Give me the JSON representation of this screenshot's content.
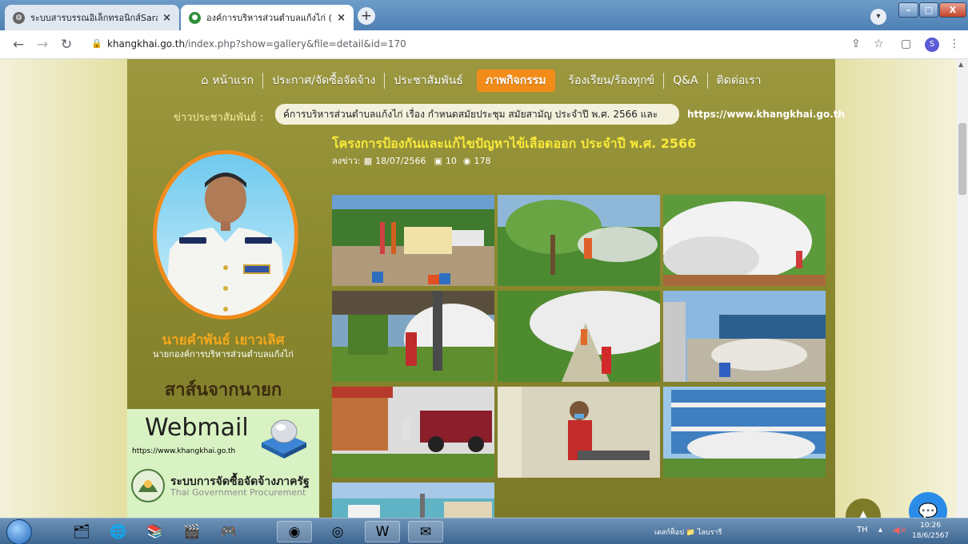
{
  "browser": {
    "tabs": [
      {
        "title": "ระบบสารบรรณอิเล็กทรอนิกส์Saraban",
        "active": false
      },
      {
        "title": "องค์การบริหารส่วนตำบลแก้งไก่ (อบต.แ",
        "active": true
      }
    ],
    "url_host": "khangkhai.go.th",
    "url_path": "/index.php?show=gallery&file=detail&id=170",
    "profile_initial": "S"
  },
  "site": {
    "menu": [
      {
        "label": "หน้าแรก",
        "icon": "home-icon"
      },
      {
        "label": "ประกาศ/จัดซื้อจัดจ้าง"
      },
      {
        "label": "ประชาสัมพันธ์"
      },
      {
        "label": "ภาพกิจกรรม",
        "active": true
      },
      {
        "label": "ร้องเรียน/ร้องทุกข์"
      },
      {
        "label": "Q&A"
      },
      {
        "label": "ติดต่อเรา"
      }
    ],
    "news_label": "ข่าวประชาสัมพันธ์ :",
    "news_ticker": "ค์การบริหารส่วนตำบลแก้งไก่ เรื่อง กำหนดสมัยประชุม สมัยสามัญ ประจำปี พ.ศ. 2566 และ",
    "news_url": "https://www.khangkhai.go.th",
    "mayor_name": "นายคำพันธ์ เยาวเลิศ",
    "mayor_title": "นายกองค์การบริหารส่วนตำบลแก้งไก่",
    "mayor_message": "สาส์นจากนายก",
    "webmail_title": "Webmail",
    "webmail_url": "https://www.khangkhai.go.th",
    "egp_title": "ระบบการจัดซื้อจัดจ้างภาครัฐ",
    "egp_subtitle": "Thai Government Procurement"
  },
  "article": {
    "title": "โครงการป้องกันและแก้ไขปัญหาไข้เลือดออก ประจำปี พ.ศ. 2566",
    "posted_label": "ลงข่าว:",
    "date": "18/07/2566",
    "image_count": "10",
    "views": "178"
  },
  "taskbar": {
    "desktop_label": "เดสก์ท็อป",
    "folder_label": "ไลบรารี",
    "lang": "TH",
    "time": "10:26",
    "date": "18/6/2567"
  }
}
